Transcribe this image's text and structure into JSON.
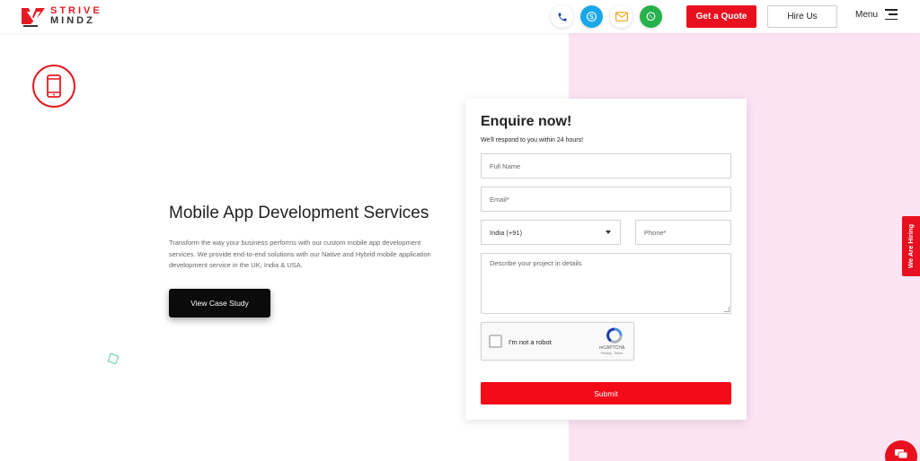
{
  "header": {
    "logo_line1": "STRIVE",
    "logo_line2": "MINDZ",
    "contact_icons": [
      "phone-icon",
      "skype-icon",
      "mail-icon",
      "whatsapp-icon"
    ],
    "quote_label": "Get a Quote",
    "hire_label": "Hire Us",
    "menu_label": "Menu"
  },
  "hero": {
    "icon": "mobile-phone-icon",
    "title": "Mobile App Development Services",
    "description": "Transform the way your business performs with our custom mobile app development services. We provide end-to-end solutions with our Native and Hybrid mobile application development service in the UK, India & USA.",
    "cta_label": "View Case Study"
  },
  "form": {
    "title": "Enquire now!",
    "subtitle": "We'll respond to you within 24 hours!",
    "name_placeholder": "Full Name",
    "email_placeholder": "Email*",
    "country_value": "India (+91)",
    "phone_placeholder": "Phone*",
    "description_placeholder": "Describe your project in details",
    "captcha_label": "I'm not a robot",
    "captcha_brand": "reCAPTCHA",
    "captcha_terms": "Privacy - Terms",
    "submit_label": "Submit"
  },
  "side": {
    "hiring_label": "We Are Hiring"
  },
  "colors": {
    "accent": "#e8101e",
    "pink_panel": "#fbe3f3",
    "skype": "#1aa7e8",
    "whatsapp": "#25b14b"
  }
}
